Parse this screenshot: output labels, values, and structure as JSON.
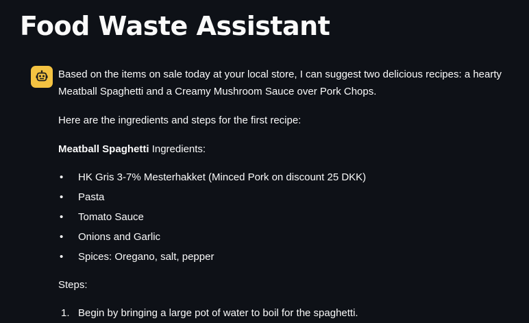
{
  "title": "Food Waste Assistant",
  "message": {
    "avatar_icon": "robot-icon",
    "intro": "Based on the items on sale today at your local store, I can suggest two delicious recipes: a hearty Meatball Spaghetti and a Creamy Mushroom Sauce over Pork Chops.",
    "line2": "Here are the ingredients and steps for the first recipe:",
    "recipe_name": "Meatball Spaghetti",
    "ingredients_label": " Ingredients:",
    "ingredients": [
      "HK Gris 3-7% Mesterhakket (Minced Pork on discount 25 DKK)",
      "Pasta",
      "Tomato Sauce",
      "Onions and Garlic",
      "Spices: Oregano, salt, pepper"
    ],
    "steps_label": "Steps:",
    "steps": [
      {
        "num": "1.",
        "text": "Begin by bringing a large pot of water to boil for the spaghetti."
      }
    ]
  },
  "colors": {
    "background": "#0e1117",
    "text": "#fafafa",
    "avatar": "#f4c342"
  }
}
